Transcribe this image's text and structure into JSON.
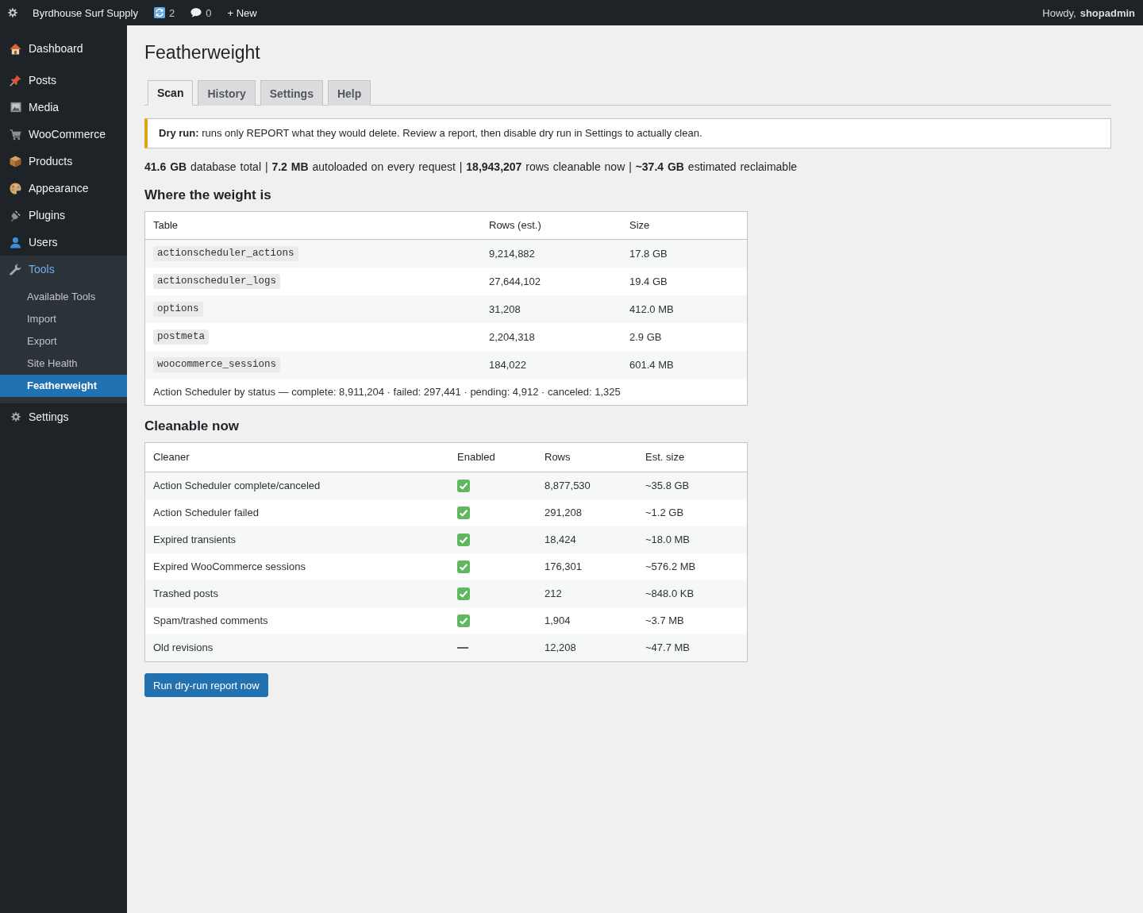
{
  "admin_bar": {
    "site_name": "Byrdhouse Surf Supply",
    "updates_count": "2",
    "comments_count": "0",
    "new_label": "+ New",
    "greeting": "Howdy, **shopadmin**"
  },
  "sidebar": {
    "items": [
      {
        "label": "Dashboard",
        "selected": false,
        "expanded": false
      },
      {
        "label": "Posts",
        "selected": false,
        "expanded": false
      },
      {
        "label": "Media",
        "selected": false,
        "expanded": false
      },
      {
        "label": "WooCommerce",
        "selected": false,
        "expanded": false
      },
      {
        "label": "Products",
        "selected": false,
        "expanded": false
      },
      {
        "label": "Appearance",
        "selected": false,
        "expanded": false
      },
      {
        "label": "Plugins",
        "selected": false,
        "expanded": false
      },
      {
        "label": "Users",
        "selected": false,
        "expanded": false
      },
      {
        "label": "Tools",
        "selected": false,
        "expanded": true,
        "children": [
          {
            "label": "Available Tools",
            "selected": false
          },
          {
            "label": "Import",
            "selected": false
          },
          {
            "label": "Export",
            "selected": false
          },
          {
            "label": "Site Health",
            "selected": false
          },
          {
            "label": "Featherweight",
            "selected": true
          }
        ]
      },
      {
        "label": "Settings",
        "selected": false,
        "expanded": false
      }
    ]
  },
  "page": {
    "title": "Featherweight",
    "tabs": [
      {
        "label": "Scan",
        "selected": true
      },
      {
        "label": "History",
        "selected": false
      },
      {
        "label": "Settings",
        "selected": false
      },
      {
        "label": "Help",
        "selected": false
      }
    ],
    "notice": {
      "text": "**Dry run:** runs only REPORT what they would delete. Review a report, then disable dry run in Settings to actually clean."
    },
    "summary": "**41.6 GB** database total | **7.2 MB** autoloaded on every request | **18,943,207** rows cleanable now | **~37.4 GB** estimated reclaimable",
    "weight_section": {
      "heading": "Where the weight is",
      "columns": [
        "Table",
        "Rows (est.)",
        "Size"
      ],
      "rows": [
        {
          "table": "actionscheduler_actions",
          "rows": "9,214,882",
          "size": "17.8 GB"
        },
        {
          "table": "actionscheduler_logs",
          "rows": "27,644,102",
          "size": "19.4 GB"
        },
        {
          "table": "options",
          "rows": "31,208",
          "size": "412.0 MB"
        },
        {
          "table": "postmeta",
          "rows": "2,204,318",
          "size": "2.9 GB"
        },
        {
          "table": "woocommerce_sessions",
          "rows": "184,022",
          "size": "601.4 MB"
        }
      ],
      "footer": "Action Scheduler by status — complete: 8,911,204 · failed: 297,441 · pending: 4,912 · canceled: 1,325"
    },
    "cleanable_section": {
      "heading": "Cleanable now",
      "columns": [
        "Cleaner",
        "Enabled",
        "Rows",
        "Est. size"
      ],
      "rows": [
        {
          "cleaner": "Action Scheduler complete/canceled",
          "enabled": true,
          "rows": "8,877,530",
          "est_size": "~35.8 GB"
        },
        {
          "cleaner": "Action Scheduler failed",
          "enabled": true,
          "rows": "291,208",
          "est_size": "~1.2 GB"
        },
        {
          "cleaner": "Expired transients",
          "enabled": true,
          "rows": "18,424",
          "est_size": "~18.0 MB"
        },
        {
          "cleaner": "Expired WooCommerce sessions",
          "enabled": true,
          "rows": "176,301",
          "est_size": "~576.2 MB"
        },
        {
          "cleaner": "Trashed posts",
          "enabled": true,
          "rows": "212",
          "est_size": "~848.0 KB"
        },
        {
          "cleaner": "Spam/trashed comments",
          "enabled": true,
          "rows": "1,904",
          "est_size": "~3.7 MB"
        },
        {
          "cleaner": "Old revisions",
          "enabled": false,
          "rows": "12,208",
          "est_size": "~47.7 MB"
        }
      ]
    },
    "run_button": "Run dry-run report now"
  }
}
